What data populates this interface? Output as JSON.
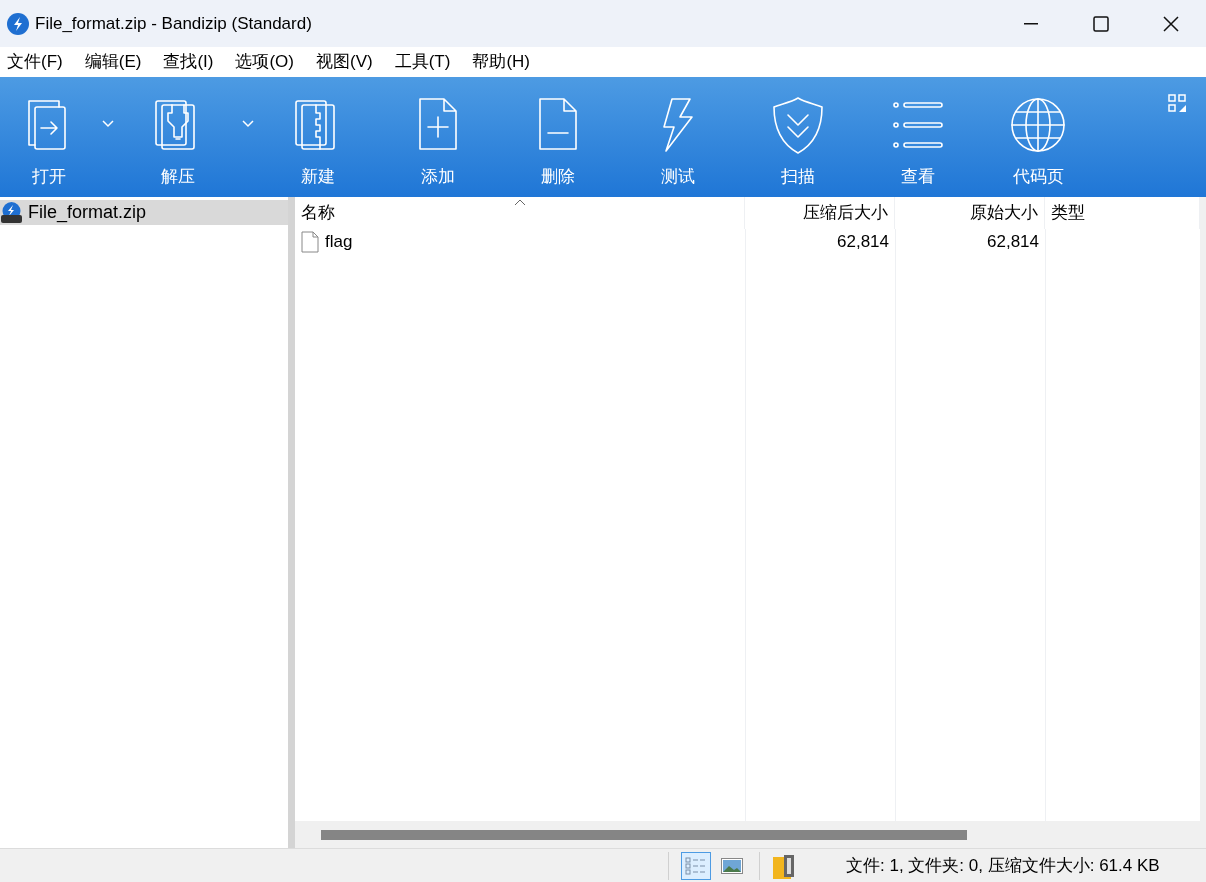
{
  "window": {
    "title": "File_format.zip - Bandizip (Standard)"
  },
  "menu": [
    "文件(F)",
    "编辑(E)",
    "查找(I)",
    "选项(O)",
    "视图(V)",
    "工具(T)",
    "帮助(H)"
  ],
  "toolbar": [
    {
      "kind": "open",
      "label": "打开",
      "dropdown": true
    },
    {
      "kind": "extract",
      "label": "解压",
      "dropdown": true
    },
    {
      "kind": "new",
      "label": "新建",
      "dropdown": false
    },
    {
      "kind": "add",
      "label": "添加",
      "dropdown": false
    },
    {
      "kind": "delete",
      "label": "删除",
      "dropdown": false
    },
    {
      "kind": "test",
      "label": "测试",
      "dropdown": false
    },
    {
      "kind": "scan",
      "label": "扫描",
      "dropdown": false
    },
    {
      "kind": "view",
      "label": "查看",
      "dropdown": false
    },
    {
      "kind": "codepage",
      "label": "代码页",
      "dropdown": false
    }
  ],
  "tree": [
    {
      "label": "File_format.zip",
      "selected": true
    }
  ],
  "table": {
    "columns": [
      {
        "label": "名称",
        "kind": "text",
        "sorted": true
      },
      {
        "label": "压缩后大小",
        "kind": "number",
        "sorted": false
      },
      {
        "label": "原始大小",
        "kind": "number",
        "sorted": false
      },
      {
        "label": "类型",
        "kind": "text",
        "sorted": false
      }
    ],
    "rows": [
      {
        "cells": [
          "flag",
          "62,814",
          "62,814",
          ""
        ],
        "selected": false
      }
    ]
  },
  "status_bar": {
    "view_modes": [
      {
        "kind": "details",
        "selected": true
      },
      {
        "kind": "thumbnails",
        "selected": false
      }
    ],
    "text": "文件: 1, 文件夹: 0, 压缩文件大小: 61.4 KB"
  }
}
